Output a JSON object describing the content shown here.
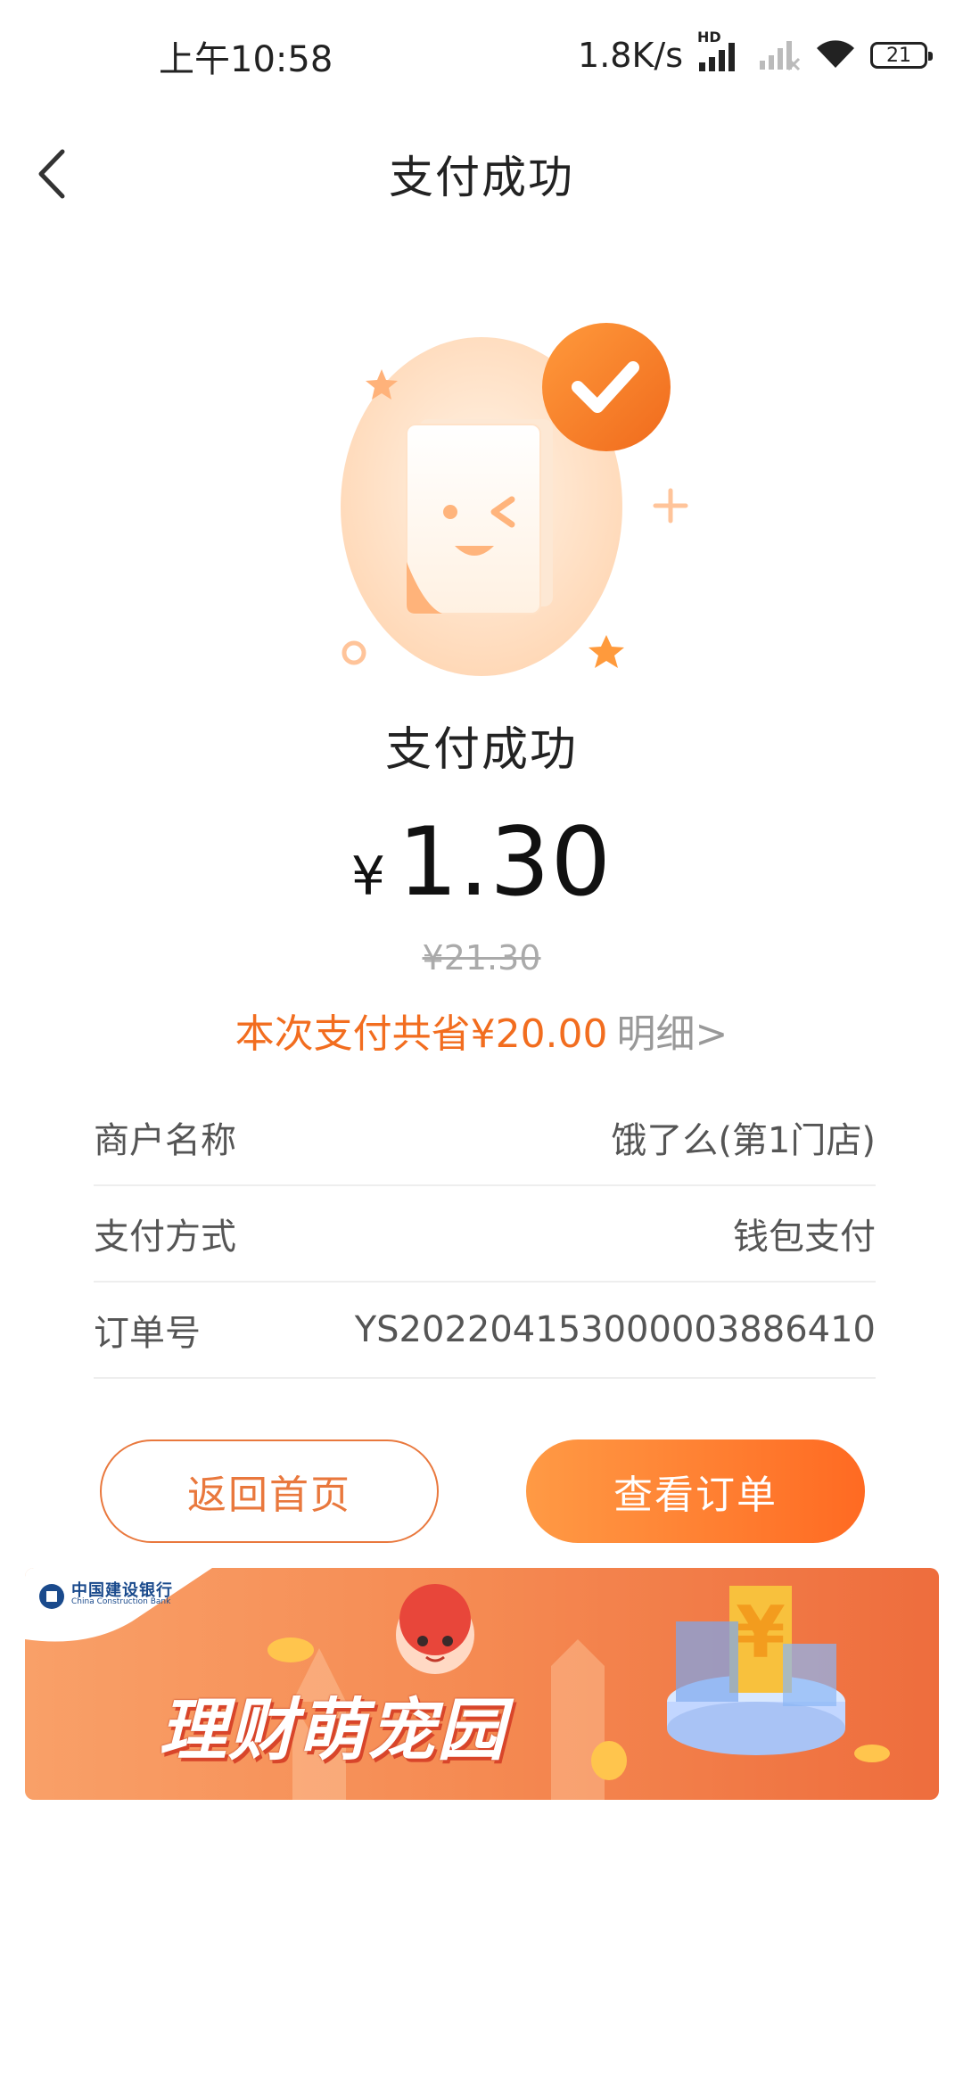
{
  "status_bar": {
    "time": "上午10:58",
    "net_speed": "1.8K/s",
    "hd_label": "HD",
    "battery": "21"
  },
  "header": {
    "title": "支付成功"
  },
  "result": {
    "title": "支付成功",
    "currency": "¥",
    "amount": "1.30",
    "original_amount": "¥21.30",
    "saving_text": "本次支付共省¥20.00",
    "detail_link": "明细>"
  },
  "info": [
    {
      "label": "商户名称",
      "value": "饿了么(第1门店)"
    },
    {
      "label": "支付方式",
      "value": "钱包支付"
    },
    {
      "label": "订单号",
      "value": "YS20220415300000388641​0"
    }
  ],
  "buttons": {
    "home": "返回首页",
    "order": "查看订单"
  },
  "banner": {
    "bank_name": "中国建设银行",
    "bank_en": "China Construction Bank",
    "slogan": "理财萌宠园"
  },
  "colors": {
    "accent": "#f26d1f",
    "button_gradient_start": "#ff9a45",
    "button_gradient_end": "#ff6a22",
    "banner_bg": "#f5894f"
  }
}
